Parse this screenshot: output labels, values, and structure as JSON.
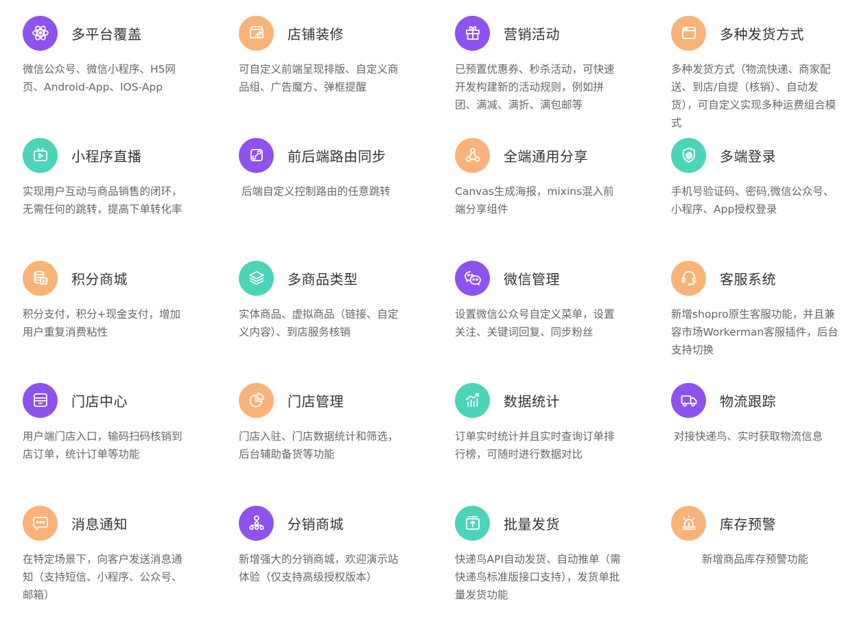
{
  "features": [
    {
      "title": "多平台覆盖",
      "desc": "微信公众号、微信小程序、H5网页、Android-App、IOS-App",
      "icon": "atom-icon",
      "color": "purple"
    },
    {
      "title": "店铺装修",
      "desc": "可自定义前端呈现排版、自定义商品组、广告魔方、弹框提醒",
      "icon": "store-decor-icon",
      "color": "orange"
    },
    {
      "title": "营销活动",
      "desc": "已预置优惠券、秒杀活动，可快速开发构建新的活动规则，例如拼团、满减、满折、满包邮等",
      "icon": "gift-icon",
      "color": "purple"
    },
    {
      "title": "多种发货方式",
      "desc": "多种发货方式（物流快递、商家配送、到店/自提（核销）、自动发货），可自定义实现多种运费组合模式",
      "icon": "browser-window-icon",
      "color": "orange"
    },
    {
      "title": "小程序直播",
      "desc": "实现用户互动与商品销售的闭环，无需任何的跳转，提高下单转化率",
      "icon": "tv-play-icon",
      "color": "green"
    },
    {
      "title": "前后端路由同步",
      "desc": "后端自定义控制路由的任意跳转",
      "icon": "link-icon",
      "color": "purple"
    },
    {
      "title": "全端通用分享",
      "desc": "Canvas生成海报，mixins混入前端分享组件",
      "icon": "share-icon",
      "color": "orange"
    },
    {
      "title": "多端登录",
      "desc": "手机号验证码、密码,微信公众号、小程序、App授权登录",
      "icon": "shield-icon",
      "color": "green"
    },
    {
      "title": "积分商城",
      "desc": "积分支付，积分+现金支付，增加用户重复消费粘性",
      "icon": "database-icon",
      "color": "orange"
    },
    {
      "title": "多商品类型",
      "desc": "实体商品、虚拟商品（链接、自定义内容）、到店服务核销",
      "icon": "layers-icon",
      "color": "green"
    },
    {
      "title": "微信管理",
      "desc": "设置微信公众号自定义菜单，设置关注、关键词回复、同步粉丝",
      "icon": "wechat-icon",
      "color": "purple"
    },
    {
      "title": "客服系统",
      "desc": "新增shopro原生客服功能，并且兼容市场Workerman客服插件，后台支持切换",
      "icon": "headset-icon",
      "color": "orange"
    },
    {
      "title": "门店中心",
      "desc": "用户端门店入口，输码扫码核销到店订单，统计订单等功能",
      "icon": "store-icon",
      "color": "purple"
    },
    {
      "title": "门店管理",
      "desc": "门店入驻、门店数据统计和筛选，后台辅助备货等功能",
      "icon": "pie-chart-icon",
      "color": "orange"
    },
    {
      "title": "数据统计",
      "desc": "订单实时统计并且实时查询订单排行榜，可随时进行数据对比",
      "icon": "bar-chart-icon",
      "color": "green"
    },
    {
      "title": "物流跟踪",
      "desc": "对接快递鸟、实时获取物流信息",
      "icon": "truck-icon",
      "color": "purple"
    },
    {
      "title": "消息通知",
      "desc": "在特定场景下，向客户发送消息通知（支持短信、小程序、公众号、邮箱）",
      "icon": "message-icon",
      "color": "orange"
    },
    {
      "title": "分销商城",
      "desc": "新增强大的分销商城，欢迎演示站体验（仅支持高级授权版本）",
      "icon": "org-tree-icon",
      "color": "purple"
    },
    {
      "title": "批量发货",
      "desc": "快递鸟API自动发货、自动推单（需快递鸟标准版接口支持），发货单批量发货功能",
      "icon": "upload-box-icon",
      "color": "green"
    },
    {
      "title": "库存预警",
      "desc": "新增商品库存预警功能",
      "icon": "alarm-icon",
      "color": "orange"
    }
  ]
}
